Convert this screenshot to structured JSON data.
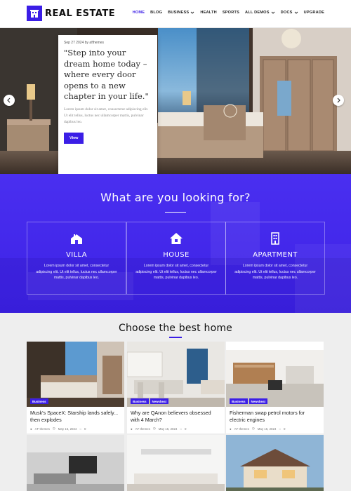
{
  "header": {
    "logo_text": "REAL ESTATE",
    "nav": [
      {
        "label": "HOME",
        "active": true,
        "dropdown": false
      },
      {
        "label": "BLOG",
        "active": false,
        "dropdown": false
      },
      {
        "label": "BUSINESS",
        "active": false,
        "dropdown": true
      },
      {
        "label": "HEALTH",
        "active": false,
        "dropdown": false
      },
      {
        "label": "SPORTS",
        "active": false,
        "dropdown": false
      },
      {
        "label": "ALL DEMOS",
        "active": false,
        "dropdown": true
      },
      {
        "label": "DOCS",
        "active": false,
        "dropdown": true
      },
      {
        "label": "UPGRADE",
        "active": false,
        "dropdown": false
      }
    ]
  },
  "hero": {
    "meta": "Sep 27 2024 by afthemes",
    "title": "\"Step into your dream home today – where every door opens to a new chapter in your life.\"",
    "excerpt": "Lorem ipsum dolor sit amet, consectetur adipiscing elit. Ut elit tellus, luctus nec ullamcorper mattis, pulvinar dapibus leo.",
    "button": "View",
    "prev_icon": "chevron-left-icon",
    "next_icon": "chevron-right-icon"
  },
  "looking": {
    "title": "What are you looking for?",
    "features": [
      {
        "icon": "villa-icon",
        "title": "VILLA",
        "text": "Lorem ipsum dolor sit amet, consectetur adipiscing elit. Ut elit tellus, luctus nec ullamcorper mattis, pulvinar dapibus leo."
      },
      {
        "icon": "house-icon",
        "title": "HOUSE",
        "text": "Lorem ipsum dolor sit amet, consectetur adipiscing elit. Ut elit tellus, luctus nec ullamcorper mattis, pulvinar dapibus leo."
      },
      {
        "icon": "apartment-icon",
        "title": "APARTMENT",
        "text": "Lorem ipsum dolor sit amet, consectetur adipiscing elit. Ut elit tellus, luctus nec ullamcorper mattis, pulvinar dapibus leo."
      }
    ]
  },
  "choose": {
    "title": "Choose the best home",
    "cards": [
      {
        "badges": [
          "Business"
        ],
        "title": "Musk's SpaceX: Starship lands safely... then explodes",
        "author": "AF themes",
        "date": "May 16, 2024",
        "comments": "0"
      },
      {
        "badges": [
          "Business",
          "Newsbeat"
        ],
        "title": "Why are QAnon believers obsessed with 4 March?",
        "author": "AF themes",
        "date": "May 16, 2024",
        "comments": "0"
      },
      {
        "badges": [
          "Business",
          "Newsbeat"
        ],
        "title": "Fisherman swap petrol motors for electric engines",
        "author": "AF themes",
        "date": "May 16, 2024",
        "comments": "0"
      }
    ]
  },
  "colors": {
    "accent": "#3b1ee6",
    "section_bg": "#eeeeee"
  }
}
